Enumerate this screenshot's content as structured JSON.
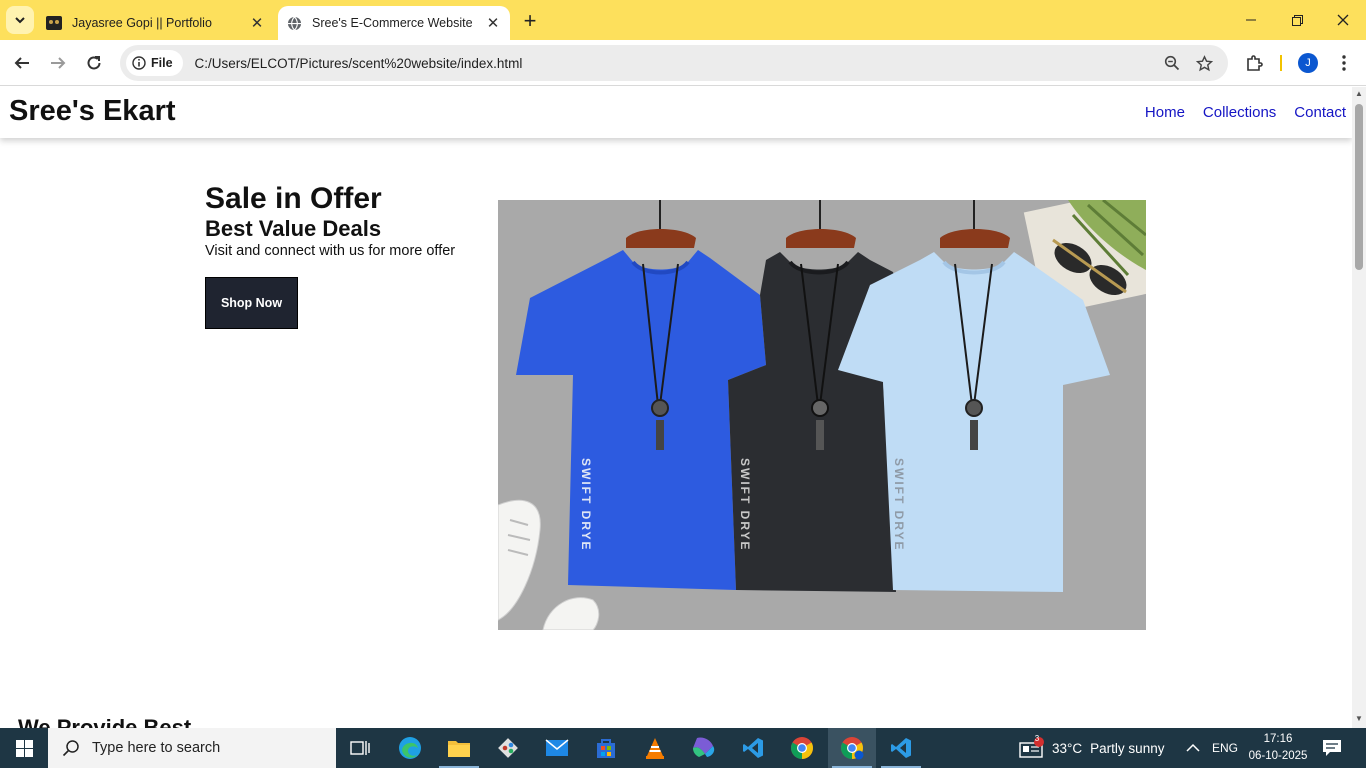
{
  "browser": {
    "tabs": [
      {
        "title": "Jayasree Gopi || Portfolio",
        "active": false
      },
      {
        "title": "Sree's E-Commerce Website",
        "active": true
      }
    ],
    "site_info_label": "File",
    "url": "C:/Users/ELCOT/Pictures/scent%20website/index.html",
    "profile_initial": "J"
  },
  "site": {
    "logo": "Sree's Ekart",
    "nav": [
      "Home",
      "Collections",
      "Contact"
    ],
    "hero": {
      "title": "Sale in Offer",
      "subtitle": "Best Value Deals",
      "description": "Visit and connect with us for more offer",
      "button": "Shop Now",
      "image_print_text": "SWIFT DRYE"
    },
    "next_section_title": "We Provide Best"
  },
  "taskbar": {
    "search_placeholder": "Type here to search",
    "notification_count": "3",
    "temperature": "33°C",
    "weather": "Partly sunny",
    "language": "ENG",
    "time": "17:16",
    "date": "06-10-2025"
  },
  "colors": {
    "tabbar": "#fde05c",
    "taskbar": "#1e3644",
    "shop_button": "#1f2430",
    "nav_link": "#1515c4"
  }
}
